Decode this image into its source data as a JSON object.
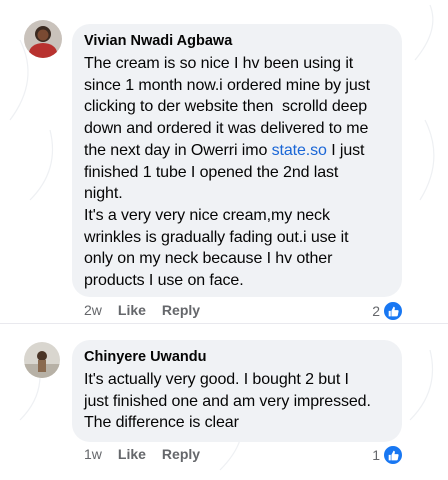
{
  "comments": [
    {
      "author": "Vivian Nwadi Agbawa",
      "text_before_link": "The cream is so nice I hv been using it\nsince 1 month now.i ordered mine by just\nclicking to der website then  scrolld deep\ndown and ordered it was delivered to me\nthe next day in Owerri imo ",
      "link": "state.so",
      "text_after_link": " I just\nfinished 1 tube I opened the 2nd last\nnight.\nIt's a very very nice cream,my neck\nwrinkles is gradually fading out.i use it\nonly on my neck because I hv other\nproducts I use on face.",
      "time": "2w",
      "like_label": "Like",
      "reply_label": "Reply",
      "reaction_count": "2",
      "reaction_icon": "thumbs-up-icon",
      "reaction_color": "#1877f2"
    },
    {
      "author": "Chinyere Uwandu",
      "text": "It's actually very good. I bought 2 but I\njust finished one and am very impressed.\nThe difference is clear",
      "time": "1w",
      "like_label": "Like",
      "reply_label": "Reply",
      "reaction_count": "1",
      "reaction_icon": "thumbs-up-icon",
      "reaction_color": "#1877f2"
    }
  ],
  "colors": {
    "bubble": "#f0f2f5",
    "link": "#1a66d6",
    "meta": "#65676b"
  }
}
